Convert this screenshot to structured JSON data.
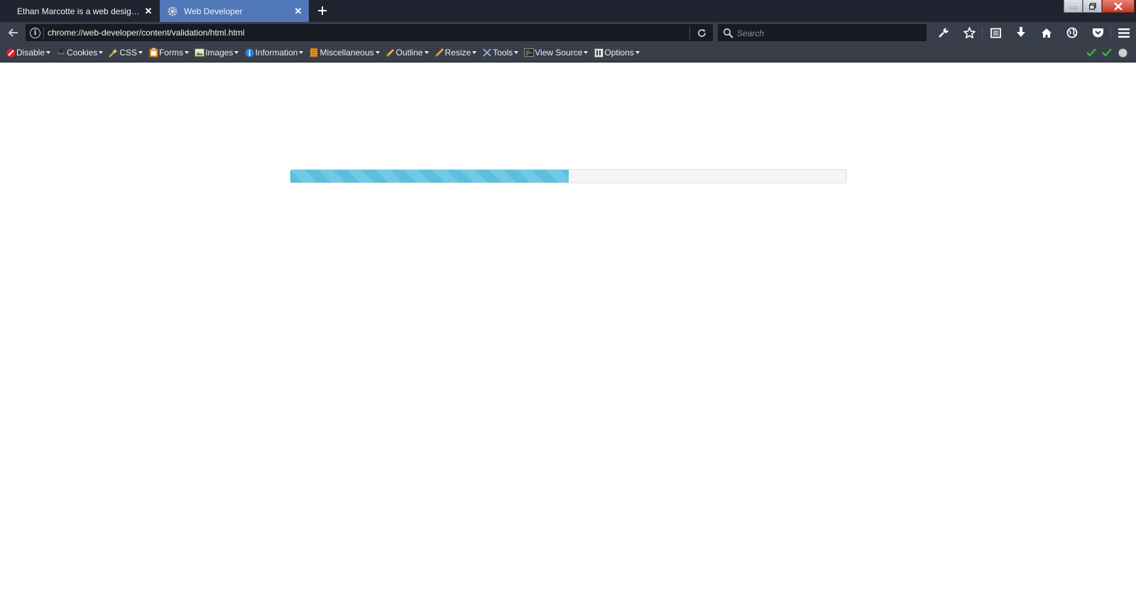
{
  "tabs": [
    {
      "title": "Ethan Marcotte is a web design...",
      "active": false
    },
    {
      "title": "Web Developer",
      "active": true
    }
  ],
  "navbar": {
    "url": "chrome://web-developer/content/validation/html.html",
    "search_placeholder": "Search"
  },
  "nav_icons": [
    "wrench-icon",
    "bookmark-star-icon",
    "reading-list-icon",
    "download-icon",
    "home-icon",
    "globe-icon",
    "pocket-icon",
    "hamburger-menu-icon"
  ],
  "devbar": {
    "items": [
      {
        "label": "Disable",
        "icon": "disable-icon"
      },
      {
        "label": "Cookies",
        "icon": "cookies-icon"
      },
      {
        "label": "CSS",
        "icon": "css-icon"
      },
      {
        "label": "Forms",
        "icon": "forms-icon"
      },
      {
        "label": "Images",
        "icon": "images-icon"
      },
      {
        "label": "Information",
        "icon": "information-icon"
      },
      {
        "label": "Miscellaneous",
        "icon": "miscellaneous-icon"
      },
      {
        "label": "Outline",
        "icon": "outline-icon"
      },
      {
        "label": "Resize",
        "icon": "resize-icon"
      },
      {
        "label": "Tools",
        "icon": "tools-icon"
      },
      {
        "label": "View Source",
        "icon": "view-source-icon"
      },
      {
        "label": "Options",
        "icon": "options-icon"
      }
    ],
    "status": [
      "check-icon",
      "check-icon",
      "status-dot-icon"
    ]
  },
  "progress": {
    "value": 0.5
  },
  "colors": {
    "accent_tab": "#5077b8",
    "progress": "#5bc0de",
    "chrome_dark": "#1f2430",
    "toolbar": "#383e4a"
  }
}
